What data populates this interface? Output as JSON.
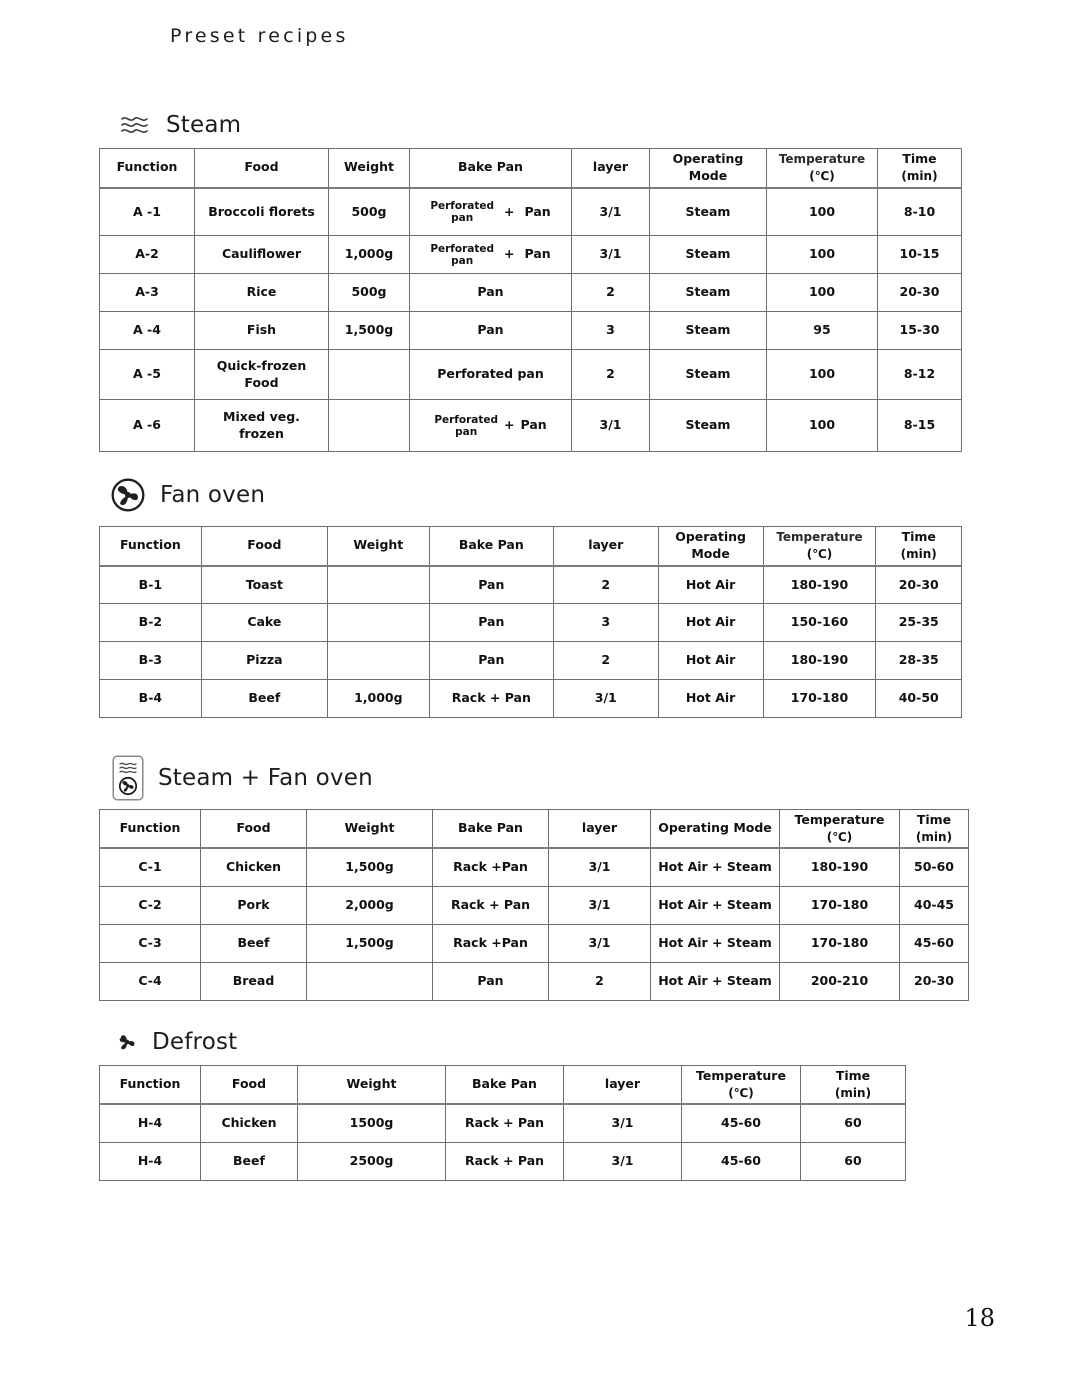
{
  "page": {
    "title": "Preset recipes",
    "number": "18"
  },
  "sections": [
    {
      "id": "steam",
      "icon": "steam-waves-icon",
      "label": "Steam",
      "headers": [
        "Function",
        "Food",
        "Weight",
        "Bake Pan",
        "layer",
        "Operating\nMode",
        "Temperature",
        "Time"
      ],
      "header_units": {
        "temperature": "(℃)",
        "time": "(min)"
      },
      "rows": [
        {
          "function": "A -1",
          "food": "Broccoli florets",
          "weight": "500g",
          "bake_pan": {
            "type": "perforated-combo",
            "small": "Perforated\npan",
            "plus": "+",
            "pan": "Pan"
          },
          "layer": "3/1",
          "mode": "Steam",
          "temperature": "100",
          "time": "8-10"
        },
        {
          "function": "A-2",
          "food": "Cauliflower",
          "weight": "1,000g",
          "bake_pan": {
            "type": "perforated-combo",
            "small": "Perforated\npan",
            "plus": "+",
            "pan": "Pan"
          },
          "layer": "3/1",
          "mode": "Steam",
          "temperature": "100",
          "time": "10-15"
        },
        {
          "function": "A-3",
          "food": "Rice",
          "weight": "500g",
          "bake_pan": {
            "type": "text",
            "text": "Pan"
          },
          "layer": "2",
          "mode": "Steam",
          "temperature": "100",
          "time": "20-30"
        },
        {
          "function": "A -4",
          "food": "Fish",
          "weight": "1,500g",
          "bake_pan": {
            "type": "text",
            "text": "Pan"
          },
          "layer": "3",
          "mode": "Steam",
          "temperature": "95",
          "time": "15-30"
        },
        {
          "function": "A -5",
          "food": "Quick-frozen\nFood",
          "weight": "",
          "bake_pan": {
            "type": "text",
            "text": "Perforated pan"
          },
          "layer": "2",
          "mode": "Steam",
          "temperature": "100",
          "time": "8-12"
        },
        {
          "function": "A -6",
          "food": "Mixed veg.\nfrozen",
          "weight": "",
          "bake_pan": {
            "type": "perforated-combo-tight",
            "small": "Perforated\npan",
            "plus": "+",
            "pan": "Pan"
          },
          "layer": "3/1",
          "mode": "Steam",
          "temperature": "100",
          "time": "8-15"
        }
      ]
    },
    {
      "id": "fan-oven",
      "icon": "fan-oven-icon",
      "label": "Fan oven",
      "headers": [
        "Function",
        "Food",
        "Weight",
        "Bake Pan",
        "layer",
        "Operating\nMode",
        "Temperature",
        "Time"
      ],
      "header_units": {
        "temperature": "(℃)",
        "time": "(min)"
      },
      "rows": [
        {
          "function": "B-1",
          "food": "Toast",
          "weight": "",
          "bake_pan": {
            "type": "text",
            "text": "Pan"
          },
          "layer": "2",
          "mode": "Hot Air",
          "temperature": "180-190",
          "time": "20-30"
        },
        {
          "function": "B-2",
          "food": "Cake",
          "weight": "",
          "bake_pan": {
            "type": "text",
            "text": "Pan"
          },
          "layer": "3",
          "mode": "Hot Air",
          "temperature": "150-160",
          "time": "25-35"
        },
        {
          "function": "B-3",
          "food": "Pizza",
          "weight": "",
          "bake_pan": {
            "type": "text",
            "text": "Pan"
          },
          "layer": "2",
          "mode": "Hot Air",
          "temperature": "180-190",
          "time": "28-35"
        },
        {
          "function": "B-4",
          "food": "Beef",
          "weight": "1,000g",
          "bake_pan": {
            "type": "text",
            "text": "Rack +  Pan"
          },
          "layer": "3/1",
          "mode": "Hot Air",
          "temperature": "170-180",
          "time": "40-50"
        }
      ]
    },
    {
      "id": "steam-fan-oven",
      "icon": "steam-plus-fan-oven-icon",
      "label": "Steam + Fan oven",
      "headers": [
        "Function",
        "Food",
        "Weight",
        "Bake Pan",
        "layer",
        "Operating Mode",
        "Temperature",
        "Time"
      ],
      "header_units": {
        "temperature": "(℃)",
        "time": "(min)"
      },
      "rows": [
        {
          "function": "C-1",
          "food": "Chicken",
          "weight": "1,500g",
          "bake_pan": {
            "type": "text",
            "text": "Rack +Pan"
          },
          "layer": "3/1",
          "mode": "Hot Air + Steam",
          "temperature": "180-190",
          "time": "50-60"
        },
        {
          "function": "C-2",
          "food": "Pork",
          "weight": "2,000g",
          "bake_pan": {
            "type": "text",
            "text": "Rack + Pan"
          },
          "layer": "3/1",
          "mode": "Hot Air + Steam",
          "temperature": "170-180",
          "time": "40-45"
        },
        {
          "function": "C-3",
          "food": "Beef",
          "weight": "1,500g",
          "bake_pan": {
            "type": "text",
            "text": "Rack +Pan"
          },
          "layer": "3/1",
          "mode": "Hot Air + Steam",
          "temperature": "170-180",
          "time": "45-60"
        },
        {
          "function": "C-4",
          "food": "Bread",
          "weight": "",
          "bake_pan": {
            "type": "text",
            "text": "Pan"
          },
          "layer": "2",
          "mode": "Hot Air + Steam",
          "temperature": "200-210",
          "time": "20-30"
        }
      ]
    },
    {
      "id": "defrost",
      "icon": "defrost-fan-icon",
      "label": "Defrost",
      "headers": [
        "Function",
        "Food",
        "Weight",
        "Bake Pan",
        "layer",
        "Temperature",
        "Time"
      ],
      "header_units": {
        "temperature": "(℃)",
        "time": "(min)"
      },
      "rows": [
        {
          "function": "H-4",
          "food": "Chicken",
          "weight": "1500g",
          "bake_pan": {
            "type": "text",
            "text": "Rack + Pan"
          },
          "layer": "3/1",
          "temperature": "45-60",
          "time": "60"
        },
        {
          "function": "H-4",
          "food": "Beef",
          "weight": "2500g",
          "bake_pan": {
            "type": "text",
            "text": "Rack + Pan"
          },
          "layer": "3/1",
          "temperature": "45-60",
          "time": "60"
        }
      ]
    }
  ]
}
